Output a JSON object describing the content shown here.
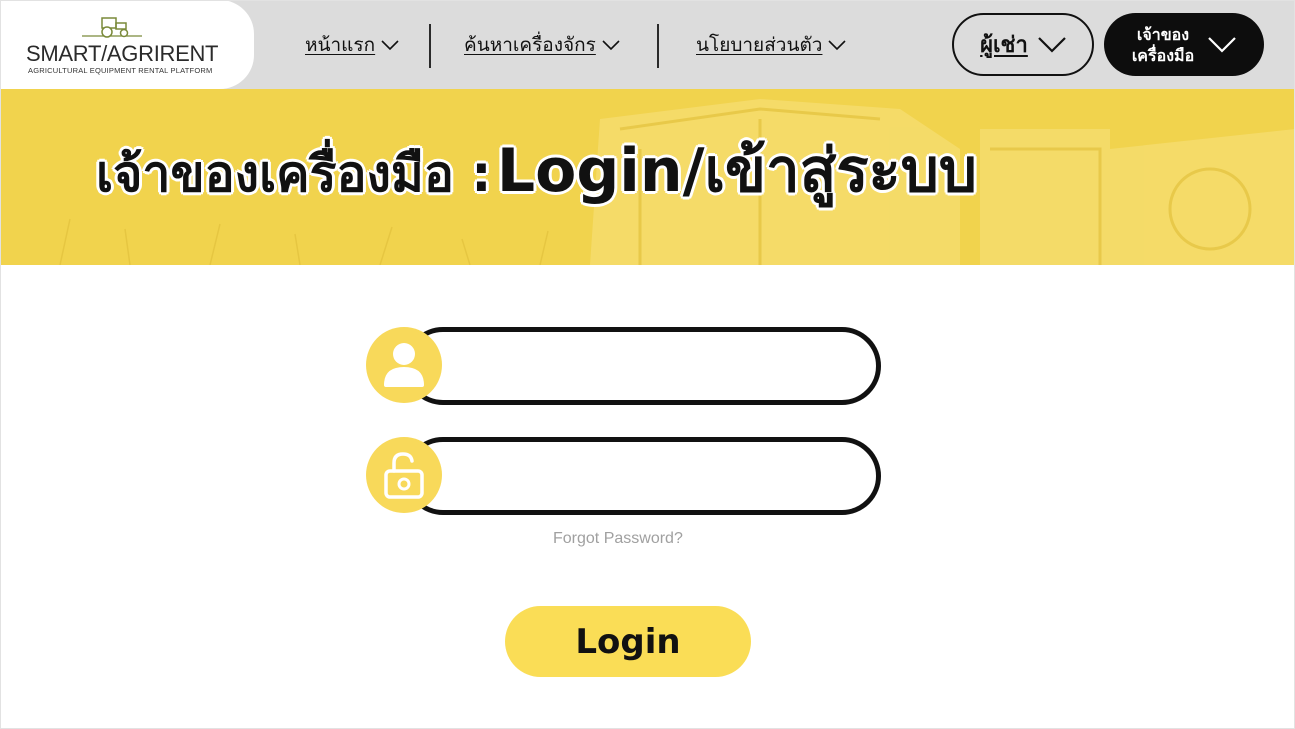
{
  "logo": {
    "name": "SMART/AGRIRENT",
    "tagline": "AGRICULTURAL EQUIPMENT RENTAL PLATFORM",
    "icon": "tractor-icon"
  },
  "nav": {
    "items": [
      {
        "label": "หน้าแรก"
      },
      {
        "label": "ค้นหาเครื่องจักร"
      },
      {
        "label": "นโยบายส่วนตัว"
      }
    ],
    "renter_label": "ผู้เช่า",
    "owner_label_line1": "เจ้าของ",
    "owner_label_line2": "เครื่องมือ"
  },
  "banner": {
    "title_role": "เจ้าของเครื่องมือ :",
    "title_action": "Login/เข้าสู่ระบบ"
  },
  "form": {
    "username_value": "",
    "password_value": "",
    "forgot_label": "Forgot Password?",
    "login_label": "Login"
  },
  "colors": {
    "accent_yellow": "#f1d34d",
    "button_yellow": "#fadd56",
    "header_gray": "#dcdcdc",
    "dark": "#0d0d0d"
  }
}
